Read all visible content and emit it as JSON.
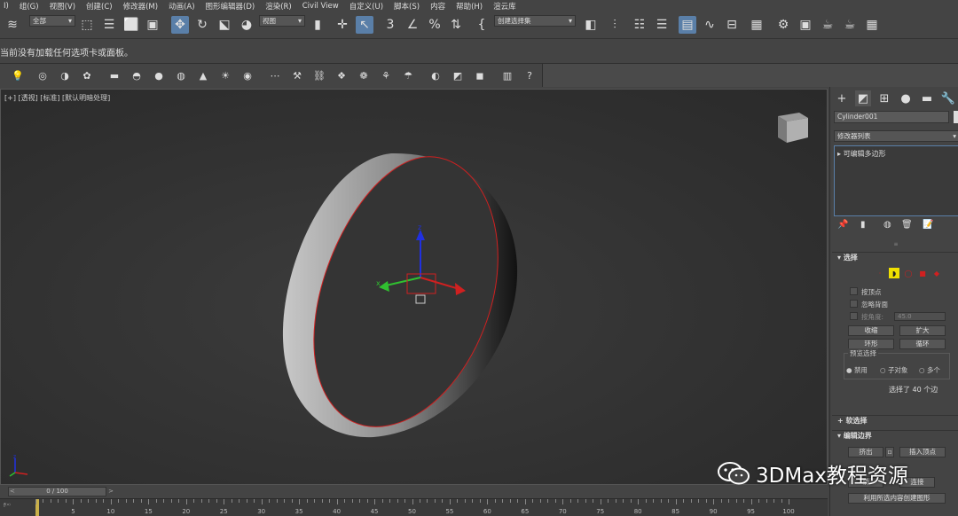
{
  "menu": [
    "I)",
    "组(G)",
    "视图(V)",
    "创建(C)",
    "修改器(M)",
    "动画(A)",
    "图形编辑器(D)",
    "渲染(R)",
    "Civil View",
    "自定义(U)",
    "脚本(S)",
    "内容",
    "帮助(H)",
    "渲云库"
  ],
  "toolbar": {
    "filter_dropdown": "全部",
    "ref_coord_dropdown": "视图",
    "named_selection_dropdown": "创建选择集"
  },
  "info_message": "当前没有加载任何选项卡或面板。",
  "viewport": {
    "label": "[+] [透视] [标准] [默认明暗处理]",
    "axis_x": "x",
    "axis_y": "y",
    "axis_z": "z"
  },
  "timeline": {
    "slider_text": "0 / 100",
    "ticks": [
      "5",
      "10",
      "15",
      "20",
      "25",
      "30",
      "35",
      "40",
      "45",
      "50",
      "55",
      "60",
      "65",
      "70",
      "75",
      "80",
      "85",
      "90",
      "95",
      "100"
    ]
  },
  "command_panel": {
    "object_name": "Cylinder001",
    "modifier_list": "修改器列表",
    "stack_item": "可编辑多边形",
    "rollout_selection": "选择",
    "by_vertex": "按顶点",
    "ignore_backfacing": "忽略背面",
    "angle_label": "按角度:",
    "angle_value": "45.0",
    "shrink": "收缩",
    "grow": "扩大",
    "ring": "环形",
    "loop": "循环",
    "preview_group": "预览选择",
    "radio_disabled": "禁用",
    "radio_subobject": "子对象",
    "radio_multi": "多个",
    "selected_text": "选择了 40 个边",
    "rollout_soft": "软选择",
    "rollout_edit_edges": "编辑边界",
    "extrude": "挤出",
    "insert_vertex": "插入顶点",
    "bridge_partial": "桥",
    "connect_partial": "连接",
    "create_shape": "利用所选内容创建图形"
  },
  "watermark": "3DMax教程资源",
  "colors": {
    "ui_bg": "#444444",
    "viewport_bg": "#2f2f2f",
    "selection_blue": "#5a7fa8",
    "edge_select_yellow": "#f0e000",
    "edge_red": "#d02020"
  }
}
